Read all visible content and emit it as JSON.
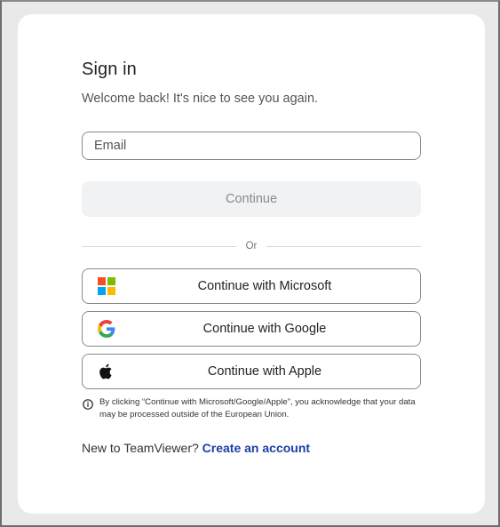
{
  "signin": {
    "title": "Sign in",
    "subtitle": "Welcome back! It's nice to see you again.",
    "email": {
      "placeholder": "Email",
      "value": ""
    },
    "continue_label": "Continue",
    "divider_label": "Or",
    "social": [
      {
        "label": "Continue with Microsoft",
        "icon": "microsoft-icon"
      },
      {
        "label": "Continue with Google",
        "icon": "google-icon"
      },
      {
        "label": "Continue with Apple",
        "icon": "apple-icon"
      }
    ],
    "disclaimer": "By clicking “Continue with Microsoft/Google/Apple”, you acknowledge that your data may be processed outside of the European Union.",
    "footer": {
      "prompt": "New to TeamViewer?",
      "link": "Create an account"
    }
  },
  "colors": {
    "link": "#1a3ea8",
    "microsoft": [
      "#f25022",
      "#7fba00",
      "#00a4ef",
      "#ffb900"
    ],
    "google": [
      "#4285f4",
      "#34a853",
      "#fbbc05",
      "#ea4335"
    ]
  }
}
